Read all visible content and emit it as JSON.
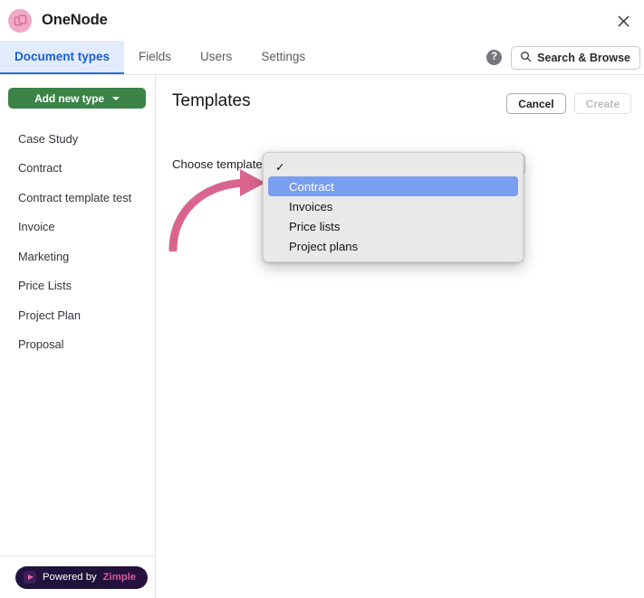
{
  "window": {
    "app_title": "OneNode",
    "logo_icon": "onenode-logo-icon",
    "close_icon": "close-icon"
  },
  "tabs": {
    "items": [
      {
        "label": "Document types",
        "active": true
      },
      {
        "label": "Fields",
        "active": false
      },
      {
        "label": "Users",
        "active": false
      },
      {
        "label": "Settings",
        "active": false
      }
    ],
    "help_icon": "help-circle-icon",
    "help_label": "?",
    "search_label": "Search & Browse",
    "search_icon": "search-icon"
  },
  "sidebar": {
    "add_button_label": "Add new type",
    "add_button_icon": "chevron-down-icon",
    "items": [
      {
        "label": "Case Study"
      },
      {
        "label": "Contract"
      },
      {
        "label": "Contract template test"
      },
      {
        "label": "Invoice"
      },
      {
        "label": "Marketing"
      },
      {
        "label": "Price Lists"
      },
      {
        "label": "Project Plan"
      },
      {
        "label": "Proposal"
      }
    ],
    "footer": {
      "powered_by": "Powered by",
      "brand": "Zimple",
      "icon": "play-triangle-icon"
    }
  },
  "main": {
    "page_title": "Templates",
    "cancel_label": "Cancel",
    "create_label": "Create",
    "form": {
      "label": "Choose template",
      "select_value": ""
    }
  },
  "dropdown": {
    "open": true,
    "options": [
      {
        "label": "",
        "checked": true,
        "selected": false
      },
      {
        "label": "Contract",
        "checked": false,
        "selected": true
      },
      {
        "label": "Invoices",
        "checked": false,
        "selected": false
      },
      {
        "label": "Price lists",
        "checked": false,
        "selected": false
      },
      {
        "label": "Project plans",
        "checked": false,
        "selected": false
      }
    ],
    "check_glyph": "✓"
  },
  "annotation": {
    "arrow_icon": "curved-arrow-icon",
    "arrow_color": "#d9658e"
  },
  "colors": {
    "accent_blue": "#2a6fe0",
    "tab_active_bg": "#e3ecfd",
    "add_button_green": "#3c8348",
    "highlight_blue": "#7a9ef0",
    "logo_pink": "#f0a9c4",
    "zimple_pink": "#e0569a"
  }
}
